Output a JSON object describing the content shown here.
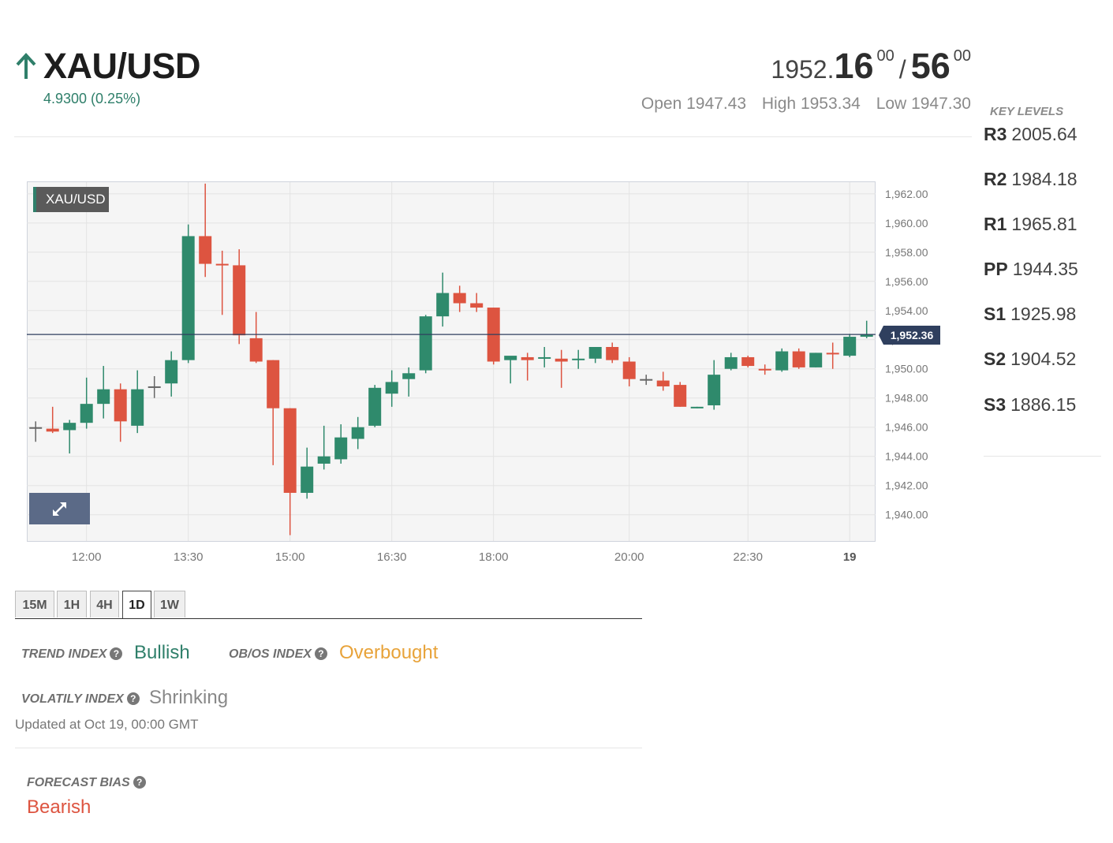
{
  "header": {
    "symbol": "XAU/USD",
    "direction_icon": "arrow-up-icon",
    "change": "4.9300 (0.25%)",
    "bid_base": "1952.",
    "bid_big": "16",
    "bid_sup": "00",
    "separator": "/",
    "ask_big": "56",
    "ask_sup": "00",
    "open_label": "Open",
    "open_value": "1947.43",
    "high_label": "High",
    "high_value": "1953.34",
    "low_label": "Low",
    "low_value": "1947.30"
  },
  "key_levels": {
    "title": "KEY LEVELS",
    "items": [
      {
        "label": "R3",
        "value": "2005.64"
      },
      {
        "label": "R2",
        "value": "1984.18"
      },
      {
        "label": "R1",
        "value": "1965.81"
      },
      {
        "label": "PP",
        "value": "1944.35"
      },
      {
        "label": "S1",
        "value": "1925.98"
      },
      {
        "label": "S2",
        "value": "1904.52"
      },
      {
        "label": "S3",
        "value": "1886.15"
      }
    ]
  },
  "chart_data": {
    "type": "candlestick",
    "title": "XAU/USD",
    "ylim": [
      1938.2,
      1962.8
    ],
    "y_ticks": [
      "1,940.00",
      "1,942.00",
      "1,944.00",
      "1,946.00",
      "1,948.00",
      "1,950.00",
      "1,952.00",
      "1,954.00",
      "1,956.00",
      "1,958.00",
      "1,960.00",
      "1,962.00"
    ],
    "y_tick_values": [
      1940,
      1942,
      1944,
      1946,
      1948,
      1950,
      1952,
      1954,
      1956,
      1958,
      1960,
      1962
    ],
    "x_ticks": [
      {
        "label": "12:00",
        "index": 3
      },
      {
        "label": "13:30",
        "index": 9
      },
      {
        "label": "15:00",
        "index": 15
      },
      {
        "label": "16:30",
        "index": 21
      },
      {
        "label": "18:00",
        "index": 27
      },
      {
        "label": "20:00",
        "index": 35
      },
      {
        "label": "22:30",
        "index": 42
      },
      {
        "label": "19",
        "index": 48,
        "bold": true
      }
    ],
    "current_price": 1952.36,
    "current_price_label": "1,952.36",
    "grid": true,
    "up_color": "#2f8a6c",
    "down_color": "#dd5440",
    "candles": [
      {
        "o": 1946.0,
        "h": 1946.4,
        "l": 1945.0,
        "c": 1946.0
      },
      {
        "o": 1945.9,
        "h": 1947.4,
        "l": 1945.6,
        "c": 1945.7
      },
      {
        "o": 1945.8,
        "h": 1946.5,
        "l": 1944.2,
        "c": 1946.3
      },
      {
        "o": 1946.3,
        "h": 1949.4,
        "l": 1945.9,
        "c": 1947.6
      },
      {
        "o": 1947.6,
        "h": 1950.2,
        "l": 1946.6,
        "c": 1948.6
      },
      {
        "o": 1948.6,
        "h": 1949.0,
        "l": 1945.0,
        "c": 1946.4
      },
      {
        "o": 1946.1,
        "h": 1949.9,
        "l": 1945.6,
        "c": 1948.6
      },
      {
        "o": 1948.8,
        "h": 1949.5,
        "l": 1948.0,
        "c": 1948.8
      },
      {
        "o": 1949.0,
        "h": 1951.2,
        "l": 1948.1,
        "c": 1950.6
      },
      {
        "o": 1950.6,
        "h": 1959.9,
        "l": 1950.4,
        "c": 1959.1
      },
      {
        "o": 1959.1,
        "h": 1962.7,
        "l": 1956.3,
        "c": 1957.2
      },
      {
        "o": 1957.2,
        "h": 1958.1,
        "l": 1953.7,
        "c": 1957.1
      },
      {
        "o": 1957.1,
        "h": 1958.2,
        "l": 1951.7,
        "c": 1952.3
      },
      {
        "o": 1952.1,
        "h": 1953.9,
        "l": 1950.4,
        "c": 1950.5
      },
      {
        "o": 1950.6,
        "h": 1950.6,
        "l": 1943.4,
        "c": 1947.3
      },
      {
        "o": 1947.3,
        "h": 1947.3,
        "l": 1938.6,
        "c": 1941.5
      },
      {
        "o": 1941.5,
        "h": 1944.6,
        "l": 1941.1,
        "c": 1943.3
      },
      {
        "o": 1943.5,
        "h": 1946.1,
        "l": 1943.1,
        "c": 1944.0
      },
      {
        "o": 1943.8,
        "h": 1946.2,
        "l": 1943.5,
        "c": 1945.3
      },
      {
        "o": 1945.2,
        "h": 1946.7,
        "l": 1944.5,
        "c": 1946.0
      },
      {
        "o": 1946.1,
        "h": 1948.9,
        "l": 1946.0,
        "c": 1948.7
      },
      {
        "o": 1948.3,
        "h": 1949.9,
        "l": 1947.4,
        "c": 1949.1
      },
      {
        "o": 1949.3,
        "h": 1950.1,
        "l": 1948.1,
        "c": 1949.7
      },
      {
        "o": 1949.9,
        "h": 1953.7,
        "l": 1949.7,
        "c": 1953.6
      },
      {
        "o": 1953.6,
        "h": 1956.6,
        "l": 1952.9,
        "c": 1955.2
      },
      {
        "o": 1955.2,
        "h": 1955.7,
        "l": 1953.9,
        "c": 1954.5
      },
      {
        "o": 1954.5,
        "h": 1955.2,
        "l": 1953.9,
        "c": 1954.2
      },
      {
        "o": 1954.2,
        "h": 1954.2,
        "l": 1950.3,
        "c": 1950.5
      },
      {
        "o": 1950.6,
        "h": 1950.8,
        "l": 1949.0,
        "c": 1950.9
      },
      {
        "o": 1950.8,
        "h": 1951.1,
        "l": 1949.2,
        "c": 1950.6
      },
      {
        "o": 1950.7,
        "h": 1951.5,
        "l": 1950.1,
        "c": 1950.8
      },
      {
        "o": 1950.7,
        "h": 1951.3,
        "l": 1948.7,
        "c": 1950.5
      },
      {
        "o": 1950.6,
        "h": 1951.3,
        "l": 1950.0,
        "c": 1950.7
      },
      {
        "o": 1950.7,
        "h": 1951.5,
        "l": 1950.4,
        "c": 1951.5
      },
      {
        "o": 1951.5,
        "h": 1951.8,
        "l": 1950.4,
        "c": 1950.6
      },
      {
        "o": 1950.5,
        "h": 1950.8,
        "l": 1948.8,
        "c": 1949.3
      },
      {
        "o": 1949.3,
        "h": 1949.6,
        "l": 1948.9,
        "c": 1949.3
      },
      {
        "o": 1949.2,
        "h": 1949.8,
        "l": 1948.5,
        "c": 1948.8
      },
      {
        "o": 1948.9,
        "h": 1949.1,
        "l": 1947.4,
        "c": 1947.4
      },
      {
        "o": 1947.3,
        "h": 1947.4,
        "l": 1947.3,
        "c": 1947.4
      },
      {
        "o": 1947.5,
        "h": 1950.6,
        "l": 1947.2,
        "c": 1949.6
      },
      {
        "o": 1950.0,
        "h": 1951.1,
        "l": 1949.9,
        "c": 1950.8
      },
      {
        "o": 1950.8,
        "h": 1950.9,
        "l": 1950.1,
        "c": 1950.2
      },
      {
        "o": 1950.0,
        "h": 1950.3,
        "l": 1949.6,
        "c": 1949.9
      },
      {
        "o": 1949.9,
        "h": 1951.4,
        "l": 1949.8,
        "c": 1951.2
      },
      {
        "o": 1951.2,
        "h": 1951.4,
        "l": 1950.0,
        "c": 1950.1
      },
      {
        "o": 1950.1,
        "h": 1951.1,
        "l": 1950.1,
        "c": 1951.1
      },
      {
        "o": 1951.1,
        "h": 1951.8,
        "l": 1950.0,
        "c": 1951.0
      },
      {
        "o": 1950.9,
        "h": 1952.4,
        "l": 1950.8,
        "c": 1952.2
      },
      {
        "o": 1952.2,
        "h": 1953.3,
        "l": 1952.1,
        "c": 1952.36
      }
    ]
  },
  "tabs": [
    "15M",
    "1H",
    "4H",
    "1D",
    "1W"
  ],
  "active_tab": "1D",
  "indices": {
    "trend_label": "TREND INDEX",
    "trend_value": "Bullish",
    "trend_color": "#2f7f6a",
    "obos_label": "OB/OS INDEX",
    "obos_value": "Overbought",
    "obos_color": "#e8a33a",
    "volatility_label": "VOLATILY INDEX",
    "volatility_value": "Shrinking",
    "volatility_color": "#888888",
    "help_icon": "question-circle-icon",
    "updated": "Updated at Oct 19, 00:00 GMT"
  },
  "forecast": {
    "label": "FORECAST BIAS",
    "value": "Bearish",
    "color": "#dd5440"
  }
}
